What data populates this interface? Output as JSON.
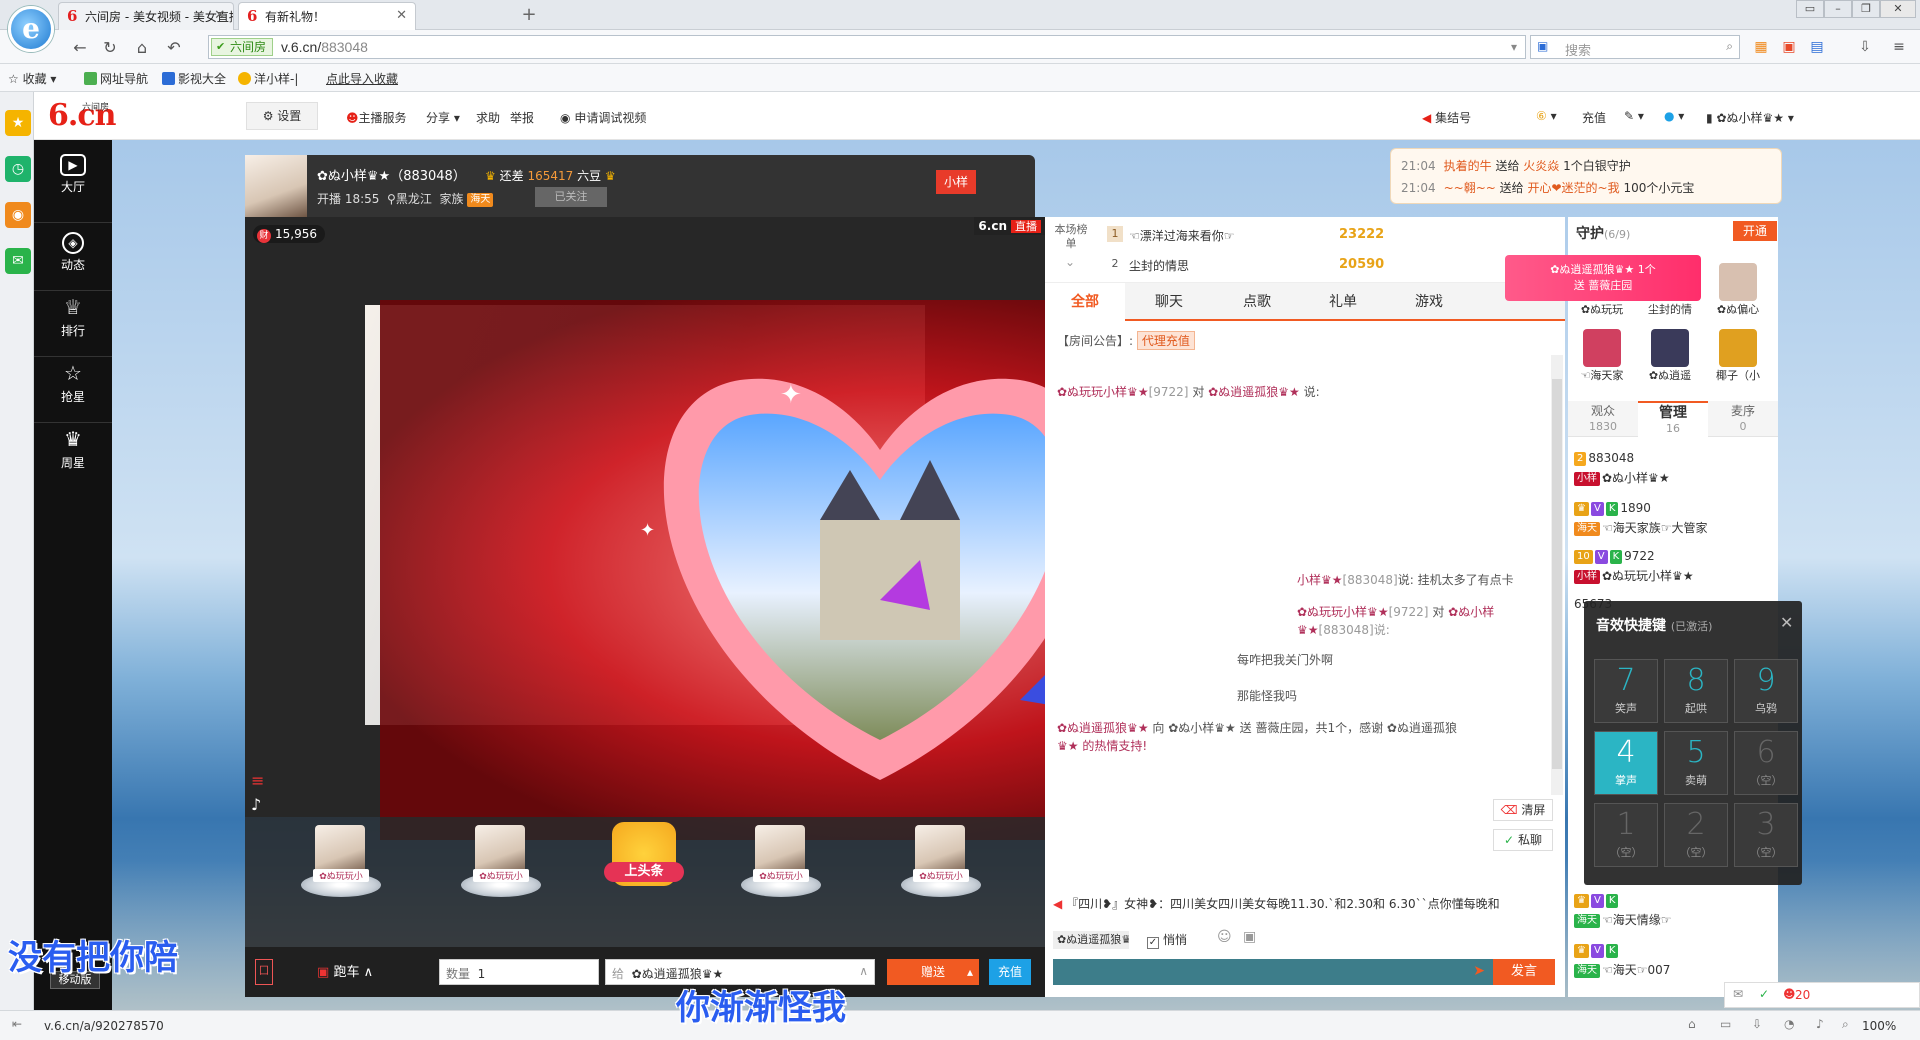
{
  "browser": {
    "tabs": [
      {
        "title": "六间房 - 美女视频 - 美女直播 -",
        "active": false
      },
      {
        "title": "有新礼物！",
        "active": true
      }
    ],
    "url_host": "v.6.cn/",
    "url_path": "883048",
    "secure_label": "六间房",
    "search_placeholder": "搜索",
    "bookmarks": [
      "收藏",
      "网址导航",
      "影视大全",
      "洋小样-|",
      "点此导入收藏"
    ],
    "status_url": "v.6.cn/a/920278570",
    "zoom": "100%"
  },
  "site": {
    "logo": "6.cn",
    "logo_sub": "六间房",
    "header": {
      "settings": "设置",
      "anchor_service": "主播服务",
      "share": "分享",
      "help": "求助",
      "report": "举报",
      "debug_video": "申请调试视频",
      "assembly": "集结号",
      "recharge": "充值",
      "user_name": "✿ぬ小样♛★"
    },
    "nav": [
      {
        "label": "大厅",
        "icon": "tv-icon"
      },
      {
        "label": "动态",
        "icon": "compass-icon"
      },
      {
        "label": "排行",
        "icon": "crown-icon"
      },
      {
        "label": "抢星",
        "icon": "star-icon"
      },
      {
        "label": "周星",
        "icon": "gift-icon"
      }
    ],
    "mobile": "移动版"
  },
  "streamer": {
    "name": "✿ぬ小样♛★（883048）",
    "start_time": "开播 18:55",
    "location": "黑龙江",
    "family_label": "家族",
    "family_tag": "海天",
    "follow": "已关注",
    "gap_label": "还差",
    "gap_value": "165417",
    "gap_unit": "六豆",
    "flag": "小样",
    "wealth": "15,956",
    "watermark": "6.cn",
    "live_label": "直播"
  },
  "seats": [
    {
      "name": "✿ぬ玩玩小"
    },
    {
      "name": "✿ぬ玩玩小"
    },
    {
      "name": "✿ぬ玩玩小"
    },
    {
      "name": "✿ぬ玩玩小"
    }
  ],
  "headline": "上头条",
  "giftbar": {
    "race": "跑车",
    "qty_label": "数量",
    "qty_value": "1",
    "to_label": "给",
    "to_value": "✿ぬ逍遥孤狼♛★",
    "send": "赠送",
    "recharge": "充值"
  },
  "ranking": {
    "label": "本场榜单",
    "rows": [
      {
        "no": "1",
        "name": "☜漂洋过海来看你☞",
        "score": "23222"
      },
      {
        "no": "2",
        "name": "尘封的情思",
        "score": "20590"
      }
    ]
  },
  "chat_tabs": [
    "全部",
    "聊天",
    "点歌",
    "礼单",
    "游戏"
  ],
  "chat": {
    "notice_label": "【房间公告】:",
    "notice_tag": "代理充值",
    "lines": [
      {
        "text_a": "✿ぬ玩玩小样♛★",
        "uid": "[9722]",
        "mid": "对",
        "text_b": "✿ぬ逍遥孤狼♛★",
        "tail": "说:"
      },
      {
        "text_a": "小样♛★",
        "uid": "[883048]",
        "mid": "说:",
        "text_b": "",
        "tail": "挂机太多了有点卡"
      },
      {
        "text_a": "✿ぬ玩玩小样♛★",
        "uid": "[9722]",
        "mid": "对",
        "text_b": "✿ぬ小样♛★",
        "tail": "[883048]说:"
      },
      {
        "text_a": "",
        "uid": "",
        "mid": "",
        "text_b": "",
        "tail": "每咋把我关门外啊"
      },
      {
        "text_a": "",
        "uid": "",
        "mid": "",
        "text_b": "",
        "tail": "那能怪我吗"
      },
      {
        "text_a": "✿ぬ逍遥孤狼♛★",
        "uid": "",
        "mid": "向 ✿ぬ小样♛★ 送",
        "text_b": "蔷薇庄园，共1个，感谢 ✿ぬ逍遥孤狼",
        "tail": "♛★ 的热情支持!"
      }
    ],
    "clear": "清屏",
    "private": "私聊",
    "broadcast": "『四川❥』女神❥：四川美女四川美女每晚11.30.`和2.30和 6.30``点你懂每晚和",
    "to_select": "✿ぬ逍遥孤狼♛",
    "whisper": "悄悄",
    "send": "发言"
  },
  "notify": [
    {
      "time": "21:04",
      "user": "执着的牛",
      "action": "送给",
      "target": "火炎焱",
      "gift": "1个白银守护"
    },
    {
      "time": "21:04",
      "user": "~~翱~~",
      "action": "送给",
      "target": "开心❤迷茫的~我",
      "gift": "100个小元宝"
    }
  ],
  "guards": {
    "title": "守护",
    "count": "(6/9)",
    "open": "开通",
    "items": [
      {
        "name": "✿ぬ玩玩"
      },
      {
        "name": "尘封的情"
      },
      {
        "name": "✿ぬ偏心"
      },
      {
        "name": "☜海天家"
      },
      {
        "name": "✿ぬ逍遥"
      },
      {
        "name": "椰子（小"
      }
    ],
    "ribbon_name": "✿ぬ逍遥孤狼♛★",
    "ribbon_action": "送 蔷薇庄园",
    "ribbon_count": "1个"
  },
  "viewer_tabs": [
    {
      "label": "观众",
      "count": "1830"
    },
    {
      "label": "管理",
      "count": "16"
    },
    {
      "label": "麦序",
      "count": "0"
    }
  ],
  "viewers": [
    {
      "id": "883048",
      "tag": "小样",
      "name": "✿ぬ小样♛★"
    },
    {
      "id": "1890",
      "tag": "海天",
      "name": "☜海天家族☞大管家"
    },
    {
      "id": "9722",
      "tag": "小样",
      "name": "✿ぬ玩玩小样♛★"
    },
    {
      "id": "65673",
      "tag": "",
      "name": ""
    },
    {
      "id": "",
      "tag": "海天",
      "name": "☜海天情缘☞"
    },
    {
      "id": "",
      "tag": "海天",
      "name": "☜海天☞007"
    }
  ],
  "sfx": {
    "title": "音效快捷键",
    "sub": "(已激活)",
    "keys": [
      {
        "num": "7",
        "label": "笑声"
      },
      {
        "num": "8",
        "label": "起哄"
      },
      {
        "num": "9",
        "label": "乌鸦"
      },
      {
        "num": "4",
        "label": "掌声"
      },
      {
        "num": "5",
        "label": "卖萌"
      },
      {
        "num": "6",
        "label": "（空）"
      },
      {
        "num": "1",
        "label": "（空）"
      },
      {
        "num": "2",
        "label": "（空）"
      },
      {
        "num": "3",
        "label": "（空）"
      }
    ]
  },
  "online_count": "20",
  "lyrics": {
    "left": "没有把你陪",
    "mid": "你渐渐怪我"
  },
  "colors": {
    "accent": "#f15a22",
    "brand": "#e62117",
    "sfx_key": "#2bb5c4"
  }
}
